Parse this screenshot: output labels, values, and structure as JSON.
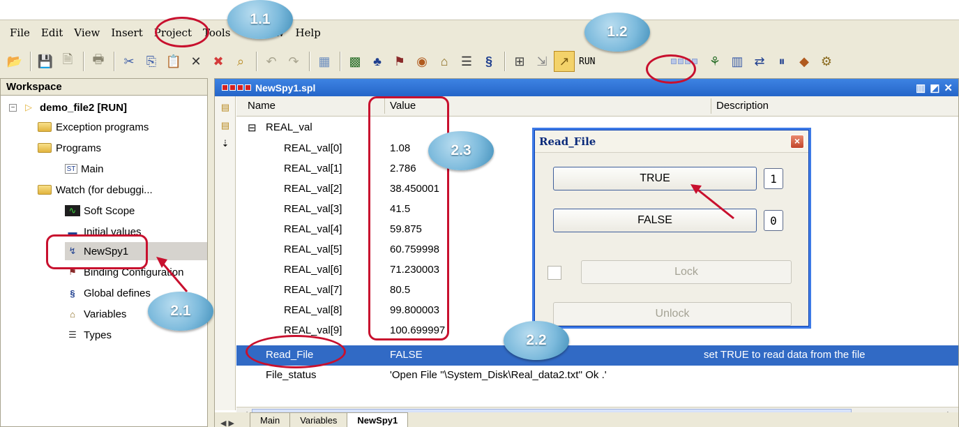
{
  "menu": [
    "File",
    "Edit",
    "View",
    "Insert",
    "Project",
    "Tools",
    "Window",
    "Help"
  ],
  "toolbar": {
    "mode_label": "RUN"
  },
  "workspace": {
    "title": "Workspace",
    "project": "demo_file2 [RUN]",
    "items": [
      "Exception programs",
      "Programs",
      "Main",
      "Watch (for debuggi...",
      "Soft Scope",
      "Initial values",
      "NewSpy1",
      "Binding Configuration",
      "Global defines",
      "Variables",
      "Types"
    ]
  },
  "spy": {
    "title": "NewSpy1.spl",
    "columns": {
      "name": "Name",
      "value": "Value",
      "description": "Description"
    },
    "group": "REAL_val",
    "rows": [
      {
        "name": "REAL_val[0]",
        "value": "1.08"
      },
      {
        "name": "REAL_val[1]",
        "value": "2.786"
      },
      {
        "name": "REAL_val[2]",
        "value": "38.450001"
      },
      {
        "name": "REAL_val[3]",
        "value": "41.5"
      },
      {
        "name": "REAL_val[4]",
        "value": "59.875"
      },
      {
        "name": "REAL_val[5]",
        "value": "60.759998"
      },
      {
        "name": "REAL_val[6]",
        "value": "71.230003"
      },
      {
        "name": "REAL_val[7]",
        "value": "80.5"
      },
      {
        "name": "REAL_val[8]",
        "value": "99.800003"
      },
      {
        "name": "REAL_val[9]",
        "value": "100.699997"
      }
    ],
    "read_file": {
      "name": "Read_File",
      "value": "FALSE",
      "description": "set TRUE to read data from the file"
    },
    "file_status": {
      "name": "File_status",
      "value": "'Open File ''\\System_Disk\\Real_data2.txt'' Ok .'"
    },
    "tabs": [
      "Main",
      "Variables",
      "NewSpy1"
    ]
  },
  "dialog": {
    "title": "Read_File",
    "true_label": "TRUE",
    "true_key": "1",
    "false_label": "FALSE",
    "false_key": "0",
    "lock_label": "Lock",
    "unlock_label": "Unlock"
  },
  "callouts": [
    "1.1",
    "1.2",
    "2.1",
    "2.2",
    "2.3"
  ],
  "colors": {
    "annotation_red": "#c8102e",
    "title_blue": "#2565c8",
    "selection": "#316ac5"
  }
}
